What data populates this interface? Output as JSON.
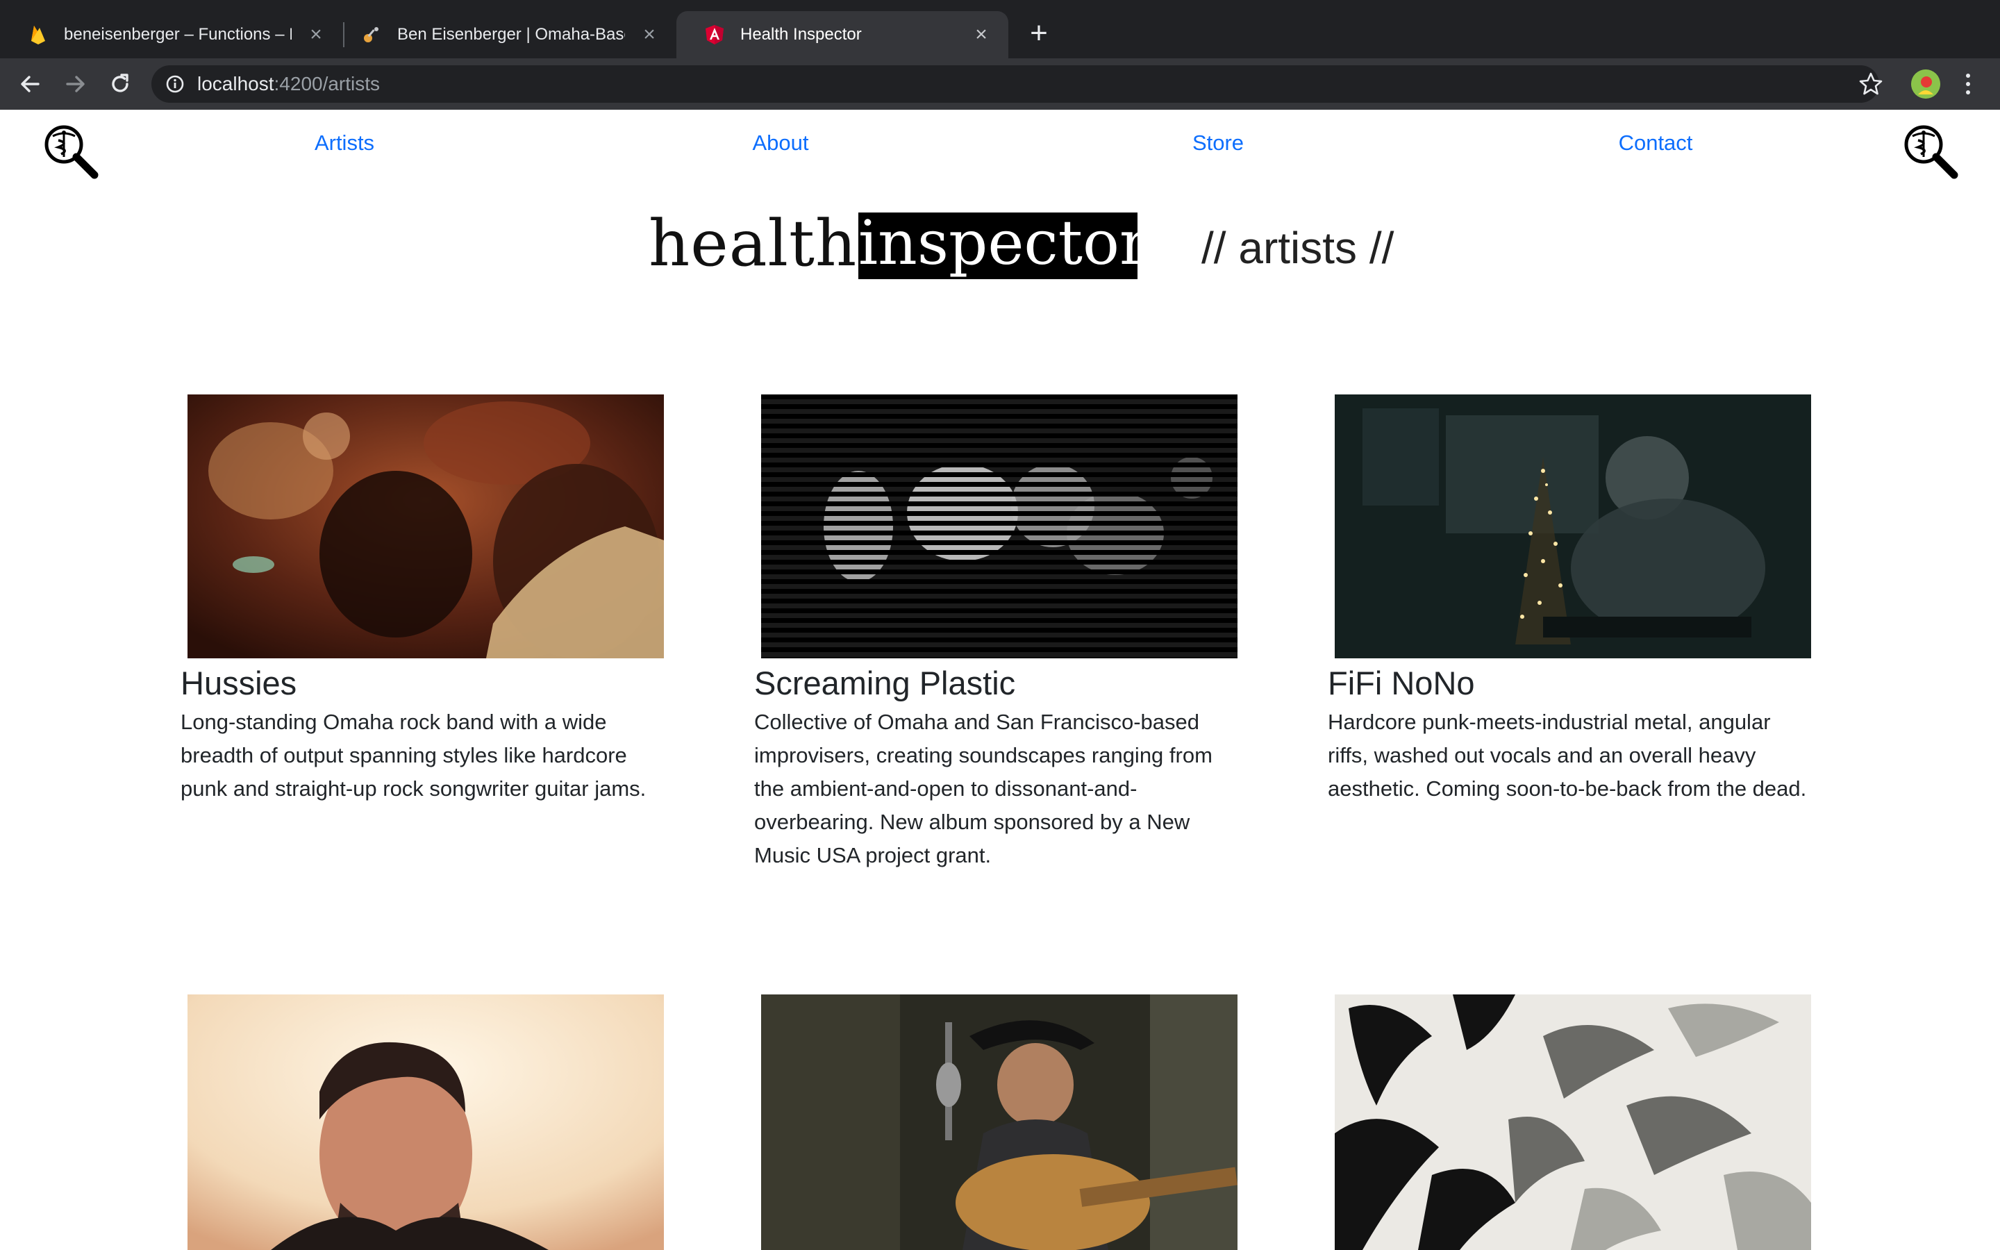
{
  "browser": {
    "tabs": [
      {
        "title": "beneisenberger – Functions – F",
        "icon": "firebase-icon",
        "active": false
      },
      {
        "title": "Ben Eisenberger | Omaha-Base",
        "icon": "guitar-icon",
        "active": false
      },
      {
        "title": "Health Inspector",
        "icon": "angular-icon",
        "active": true
      }
    ],
    "new_tab_label": "+",
    "close_label": "×",
    "url_host": "localhost",
    "url_rest": ":4200/artists"
  },
  "nav": {
    "items": [
      {
        "label": "Artists"
      },
      {
        "label": "About"
      },
      {
        "label": "Store"
      },
      {
        "label": "Contact"
      }
    ],
    "logo_icon": "magnifier-caduceus-icon"
  },
  "brand": {
    "word1": "health",
    "word2": "inspector",
    "section": "// artists //"
  },
  "artists": [
    {
      "name": "Hussies",
      "description": "Long-standing Omaha rock band with a wide breadth of output spanning styles like hardcore punk and straight-up rock songwriter guitar jams."
    },
    {
      "name": "Screaming Plastic",
      "description": "Collective of Omaha and San Francisco-based improvisers, creating soundscapes ranging from the ambient-and-open to dissonant-and-overbearing. New album sponsored by a New Music USA project grant."
    },
    {
      "name": "FiFi NoNo",
      "description": "Hardcore punk-meets-industrial metal, angular riffs, washed out vocals and an overall heavy aesthetic. Coming soon-to-be-back from the dead."
    }
  ],
  "colors": {
    "link": "#0d6efd",
    "chrome_dark": "#202124",
    "chrome_toolbar": "#35363a",
    "text": "#212529"
  }
}
